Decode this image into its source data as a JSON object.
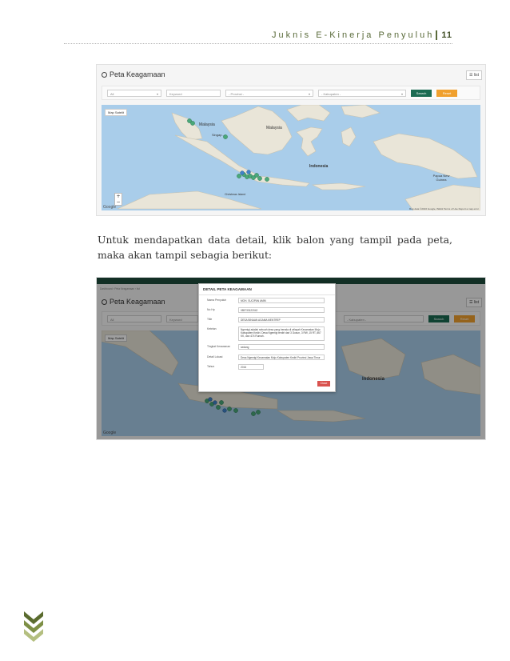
{
  "header": {
    "title": "Juknis E-Kinerja Penyuluh",
    "page_number": "11"
  },
  "screenshot1": {
    "title": "Peta Keagamaan",
    "menu_label": "☰ list",
    "filters": {
      "type": "All",
      "keyword_placeholder": "Keyword",
      "province": "- Provinsi -",
      "regency": "- Kabupaten -",
      "search_label": "Search",
      "reset_label": "Reset"
    },
    "map": {
      "map_type": "Map  Satelit",
      "labels": {
        "malaysia1": "Malaysia",
        "malaysia2": "Malaysia",
        "singapore": "Singap...",
        "indonesia": "Indonesia",
        "png": "Papua New Guinea",
        "christmas": "Christmas Island"
      },
      "google": "Google",
      "footer": "Map data ©2016 Google, INEGI  Terms of Use  Report a map error"
    }
  },
  "paragraph": "Untuk mendapatkan data detail, klik balon yang tampil pada peta, maka akan tampil sebagia berikut:",
  "screenshot2": {
    "breadcrumb": "Dashboard  ›  Peta Keagamaan  ›  list",
    "title": "Peta Keagamaan",
    "menu_label": "☰ list",
    "filter_type": "All",
    "filter_keyword": "Keyword",
    "filter_regency": "- Kabupaten -",
    "search_label": "Search",
    "reset_label": "Reset",
    "map_type": "Map  Satelit",
    "indonesia_label": "Indonesia",
    "google": "Google",
    "modal": {
      "title": "DETAIL PETA KEAGAMAAN",
      "fields": [
        {
          "label": "Nama Penyuluh",
          "value": "MOH. SUCIPAN AMIN"
        },
        {
          "label": "No Hp",
          "value": "085733122042"
        },
        {
          "label": "Title",
          "value": "DESA BINAAN AGAMA MENTREP"
        },
        {
          "label": "Ketelan",
          "value": "Ngemigi adalah sebuah desa yang berada di wilayah Kecamatan Mojo Kabupaten Kediri. Desa Ngemigi terdiri dari 3 Dusun, 3 RW, 15 RT, 867 KK, dan 474 Rumah."
        },
        {
          "label": "Tingkat Kerawanan",
          "value": "sedang"
        },
        {
          "label": "Detail Lokasi",
          "value": "Desa Ngemigi Kecamatan Mojo Kabupaten Kediri Provinsi Jawa Timur"
        },
        {
          "label": "Tahun",
          "value": "2016"
        }
      ],
      "close_label": "Close"
    }
  }
}
